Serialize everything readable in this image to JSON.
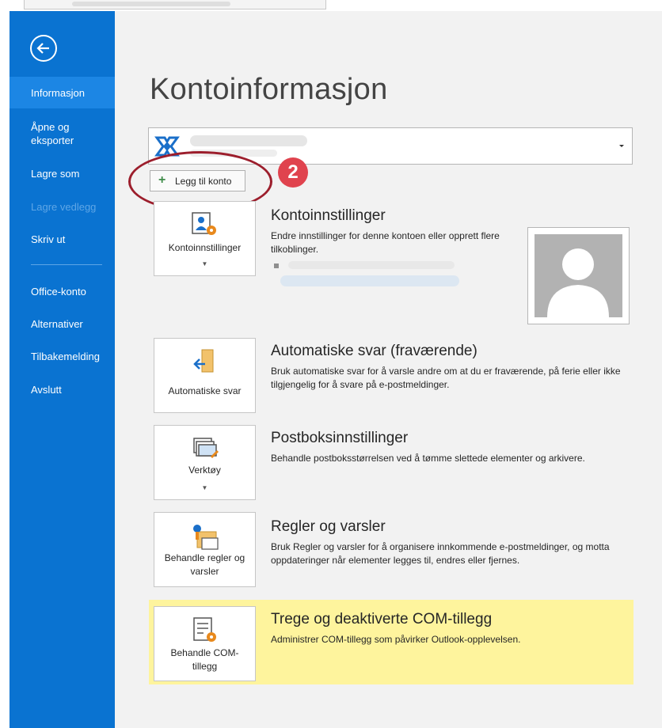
{
  "sidebar": {
    "items": [
      {
        "label": "Informasjon"
      },
      {
        "label": "Åpne og\neksporter"
      },
      {
        "label": "Lagre som"
      },
      {
        "label": "Lagre vedlegg"
      },
      {
        "label": "Skriv ut"
      },
      {
        "label": "Office-konto"
      },
      {
        "label": "Alternativer"
      },
      {
        "label": "Tilbakemelding"
      },
      {
        "label": "Avslutt"
      }
    ]
  },
  "main": {
    "title": "Kontoinformasjon",
    "add_account_label": "Legg til konto",
    "callout_number": "2",
    "sections": [
      {
        "tile_label": "Kontoinnstillinger",
        "title": "Kontoinnstillinger",
        "description": "Endre innstillinger for denne kontoen eller opprett flere tilkoblinger."
      },
      {
        "tile_label": "Automatiske svar",
        "title": "Automatiske svar (fraværende)",
        "description": "Bruk automatiske svar for å varsle andre om at du er fraværende, på ferie eller ikke tilgjengelig for å svare på e-postmeldinger."
      },
      {
        "tile_label": "Verktøy",
        "title": "Postboksinnstillinger",
        "description": "Behandle postboksstørrelsen ved å tømme slettede elementer og arkivere."
      },
      {
        "tile_label": "Behandle regler og varsler",
        "title": "Regler og varsler",
        "description": "Bruk Regler og varsler for å organisere innkommende e-postmeldinger, og motta oppdateringer når elementer legges til, endres eller fjernes."
      },
      {
        "tile_label": "Behandle COM-tillegg",
        "title": "Trege og deaktiverte COM-tillegg",
        "description": "Administrer COM-tillegg som påvirker Outlook-opplevelsen."
      }
    ]
  },
  "colors": {
    "sidebar": "#0a73d1",
    "sidebar_active": "#1c86e4",
    "highlight": "#fef49d",
    "callout": "#e0434e",
    "accent_orange": "#e8891c"
  },
  "icons": [
    "back-arrow-icon",
    "exchange-logo-icon",
    "chevron-down-icon",
    "plus-icon",
    "account-settings-icon",
    "automatic-replies-icon",
    "tools-icon",
    "rules-icon",
    "com-addins-icon",
    "profile-silhouette-icon"
  ]
}
